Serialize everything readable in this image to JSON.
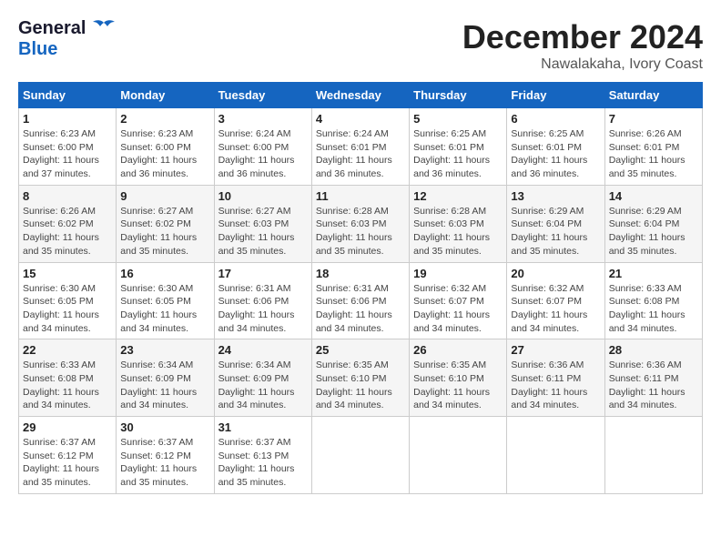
{
  "header": {
    "logo_general": "General",
    "logo_blue": "Blue",
    "title": "December 2024",
    "subtitle": "Nawalakaha, Ivory Coast"
  },
  "calendar": {
    "days_of_week": [
      "Sunday",
      "Monday",
      "Tuesday",
      "Wednesday",
      "Thursday",
      "Friday",
      "Saturday"
    ],
    "weeks": [
      [
        {
          "day": "",
          "info": ""
        },
        {
          "day": "2",
          "info": "Sunrise: 6:23 AM\nSunset: 6:00 PM\nDaylight: 11 hours\nand 36 minutes."
        },
        {
          "day": "3",
          "info": "Sunrise: 6:24 AM\nSunset: 6:00 PM\nDaylight: 11 hours\nand 36 minutes."
        },
        {
          "day": "4",
          "info": "Sunrise: 6:24 AM\nSunset: 6:01 PM\nDaylight: 11 hours\nand 36 minutes."
        },
        {
          "day": "5",
          "info": "Sunrise: 6:25 AM\nSunset: 6:01 PM\nDaylight: 11 hours\nand 36 minutes."
        },
        {
          "day": "6",
          "info": "Sunrise: 6:25 AM\nSunset: 6:01 PM\nDaylight: 11 hours\nand 36 minutes."
        },
        {
          "day": "7",
          "info": "Sunrise: 6:26 AM\nSunset: 6:01 PM\nDaylight: 11 hours\nand 35 minutes."
        }
      ],
      [
        {
          "day": "1",
          "info": "Sunrise: 6:23 AM\nSunset: 6:00 PM\nDaylight: 11 hours\nand 37 minutes."
        },
        {
          "day": "",
          "info": ""
        },
        {
          "day": "",
          "info": ""
        },
        {
          "day": "",
          "info": ""
        },
        {
          "day": "",
          "info": ""
        },
        {
          "day": "",
          "info": ""
        },
        {
          "day": "",
          "info": ""
        }
      ],
      [
        {
          "day": "8",
          "info": "Sunrise: 6:26 AM\nSunset: 6:02 PM\nDaylight: 11 hours\nand 35 minutes."
        },
        {
          "day": "9",
          "info": "Sunrise: 6:27 AM\nSunset: 6:02 PM\nDaylight: 11 hours\nand 35 minutes."
        },
        {
          "day": "10",
          "info": "Sunrise: 6:27 AM\nSunset: 6:03 PM\nDaylight: 11 hours\nand 35 minutes."
        },
        {
          "day": "11",
          "info": "Sunrise: 6:28 AM\nSunset: 6:03 PM\nDaylight: 11 hours\nand 35 minutes."
        },
        {
          "day": "12",
          "info": "Sunrise: 6:28 AM\nSunset: 6:03 PM\nDaylight: 11 hours\nand 35 minutes."
        },
        {
          "day": "13",
          "info": "Sunrise: 6:29 AM\nSunset: 6:04 PM\nDaylight: 11 hours\nand 35 minutes."
        },
        {
          "day": "14",
          "info": "Sunrise: 6:29 AM\nSunset: 6:04 PM\nDaylight: 11 hours\nand 35 minutes."
        }
      ],
      [
        {
          "day": "15",
          "info": "Sunrise: 6:30 AM\nSunset: 6:05 PM\nDaylight: 11 hours\nand 34 minutes."
        },
        {
          "day": "16",
          "info": "Sunrise: 6:30 AM\nSunset: 6:05 PM\nDaylight: 11 hours\nand 34 minutes."
        },
        {
          "day": "17",
          "info": "Sunrise: 6:31 AM\nSunset: 6:06 PM\nDaylight: 11 hours\nand 34 minutes."
        },
        {
          "day": "18",
          "info": "Sunrise: 6:31 AM\nSunset: 6:06 PM\nDaylight: 11 hours\nand 34 minutes."
        },
        {
          "day": "19",
          "info": "Sunrise: 6:32 AM\nSunset: 6:07 PM\nDaylight: 11 hours\nand 34 minutes."
        },
        {
          "day": "20",
          "info": "Sunrise: 6:32 AM\nSunset: 6:07 PM\nDaylight: 11 hours\nand 34 minutes."
        },
        {
          "day": "21",
          "info": "Sunrise: 6:33 AM\nSunset: 6:08 PM\nDaylight: 11 hours\nand 34 minutes."
        }
      ],
      [
        {
          "day": "22",
          "info": "Sunrise: 6:33 AM\nSunset: 6:08 PM\nDaylight: 11 hours\nand 34 minutes."
        },
        {
          "day": "23",
          "info": "Sunrise: 6:34 AM\nSunset: 6:09 PM\nDaylight: 11 hours\nand 34 minutes."
        },
        {
          "day": "24",
          "info": "Sunrise: 6:34 AM\nSunset: 6:09 PM\nDaylight: 11 hours\nand 34 minutes."
        },
        {
          "day": "25",
          "info": "Sunrise: 6:35 AM\nSunset: 6:10 PM\nDaylight: 11 hours\nand 34 minutes."
        },
        {
          "day": "26",
          "info": "Sunrise: 6:35 AM\nSunset: 6:10 PM\nDaylight: 11 hours\nand 34 minutes."
        },
        {
          "day": "27",
          "info": "Sunrise: 6:36 AM\nSunset: 6:11 PM\nDaylight: 11 hours\nand 34 minutes."
        },
        {
          "day": "28",
          "info": "Sunrise: 6:36 AM\nSunset: 6:11 PM\nDaylight: 11 hours\nand 34 minutes."
        }
      ],
      [
        {
          "day": "29",
          "info": "Sunrise: 6:37 AM\nSunset: 6:12 PM\nDaylight: 11 hours\nand 35 minutes."
        },
        {
          "day": "30",
          "info": "Sunrise: 6:37 AM\nSunset: 6:12 PM\nDaylight: 11 hours\nand 35 minutes."
        },
        {
          "day": "31",
          "info": "Sunrise: 6:37 AM\nSunset: 6:13 PM\nDaylight: 11 hours\nand 35 minutes."
        },
        {
          "day": "",
          "info": ""
        },
        {
          "day": "",
          "info": ""
        },
        {
          "day": "",
          "info": ""
        },
        {
          "day": "",
          "info": ""
        }
      ]
    ]
  }
}
